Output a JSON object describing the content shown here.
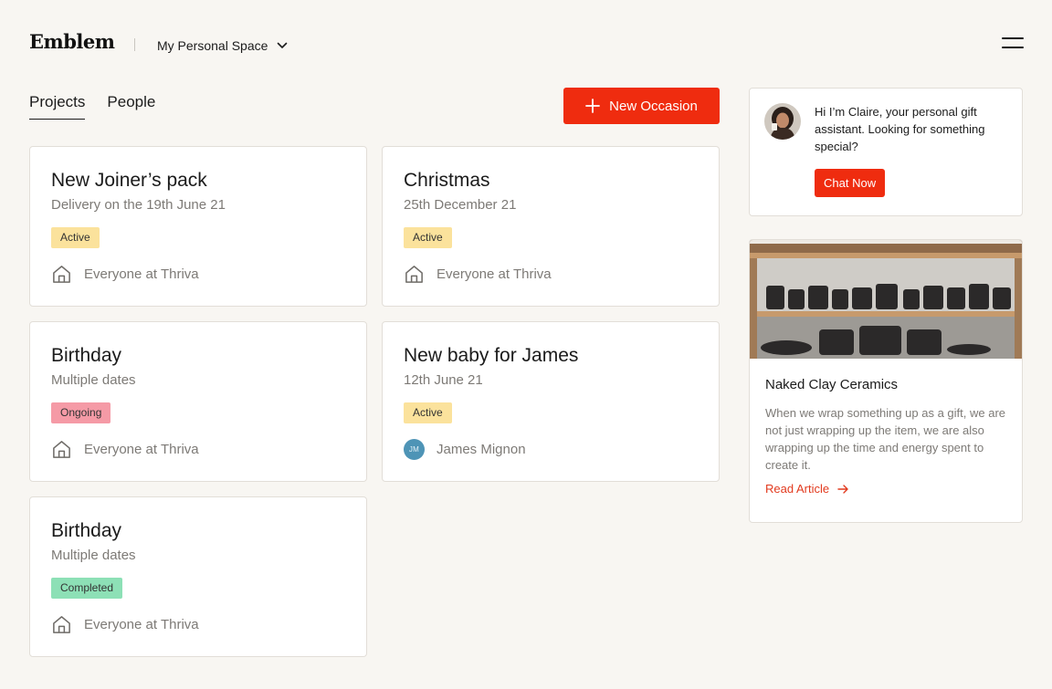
{
  "header": {
    "logo": "Emblem",
    "space_selector": "My Personal Space",
    "menu_icon": "hamburger-icon"
  },
  "tabs": [
    {
      "label": "Projects",
      "active": true
    },
    {
      "label": "People",
      "active": false
    }
  ],
  "actions": {
    "new_occasion": "New Occasion"
  },
  "projects": [
    {
      "title": "New Joiner’s pack",
      "subtitle": "Delivery on the 19th June 21",
      "status": "Active",
      "audience": "Everyone at Thriva"
    },
    {
      "title": "Christmas",
      "subtitle": "25th December 21",
      "status": "Active",
      "audience": "Everyone at Thriva"
    },
    {
      "title": "Birthday",
      "subtitle": "Multiple dates",
      "status": "Ongoing",
      "audience": "Everyone at Thriva"
    },
    {
      "title": "New baby for James",
      "subtitle": "12th June 21",
      "status": "Active",
      "audience": "James Mignon",
      "initials": "JM"
    },
    {
      "title": "Birthday",
      "subtitle": "Multiple dates",
      "status": "Completed",
      "audience": "Everyone at Thriva"
    }
  ],
  "assistant": {
    "message": "Hi I’m Claire, your personal gift assistant. Looking for something special?",
    "button": "Chat Now"
  },
  "article": {
    "title": "Naked Clay Ceramics",
    "body": "When we wrap something up as a gift, we are not just wrapping up the item, we are also wrapping up the time and energy spent to create it.",
    "link": "Read Article"
  },
  "colors": {
    "accent": "#ef2c0f",
    "background": "#f8f6f2",
    "badge_active": "#fbe29c",
    "badge_ongoing": "#f59aa6",
    "badge_completed": "#8de0b6"
  }
}
